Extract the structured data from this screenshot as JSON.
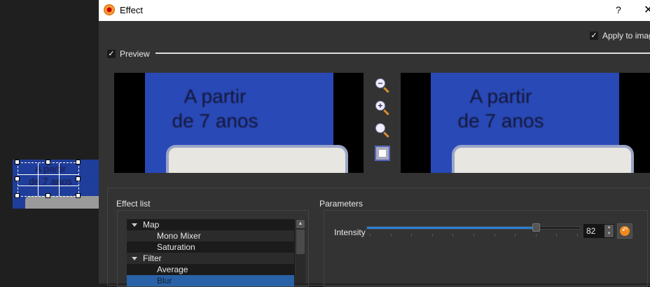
{
  "canvas": {
    "image_text_line1": "A partir",
    "image_text_line2": "de 7 anos"
  },
  "dialog": {
    "title": "Effect",
    "help": "?",
    "close": "✕",
    "apply_to_image": "Apply to image",
    "apply_checked": true,
    "preview_label": "Preview",
    "preview_checked": true
  },
  "preview": {
    "image_text_line1": "A partir",
    "image_text_line2": "de 7 anos"
  },
  "zoom_tools": [
    "zoom-out-icon",
    "zoom-in-icon",
    "zoom-actual-icon",
    "fit-icon"
  ],
  "effect_list": {
    "label": "Effect list",
    "items": [
      {
        "label": "Map",
        "type": "group"
      },
      {
        "label": "Mono Mixer",
        "type": "item"
      },
      {
        "label": "Saturation",
        "type": "item"
      },
      {
        "label": "Filter",
        "type": "group"
      },
      {
        "label": "Average",
        "type": "item"
      },
      {
        "label": "Blur",
        "type": "item",
        "selected": true
      }
    ]
  },
  "parameters": {
    "label": "Parameters",
    "intensity_label": "Intensity",
    "intensity_value": "82",
    "intensity_percent": 82
  },
  "colors": {
    "accent": "#2a7fd4",
    "selection": "#2a62a8",
    "reset": "#f08a1c"
  }
}
